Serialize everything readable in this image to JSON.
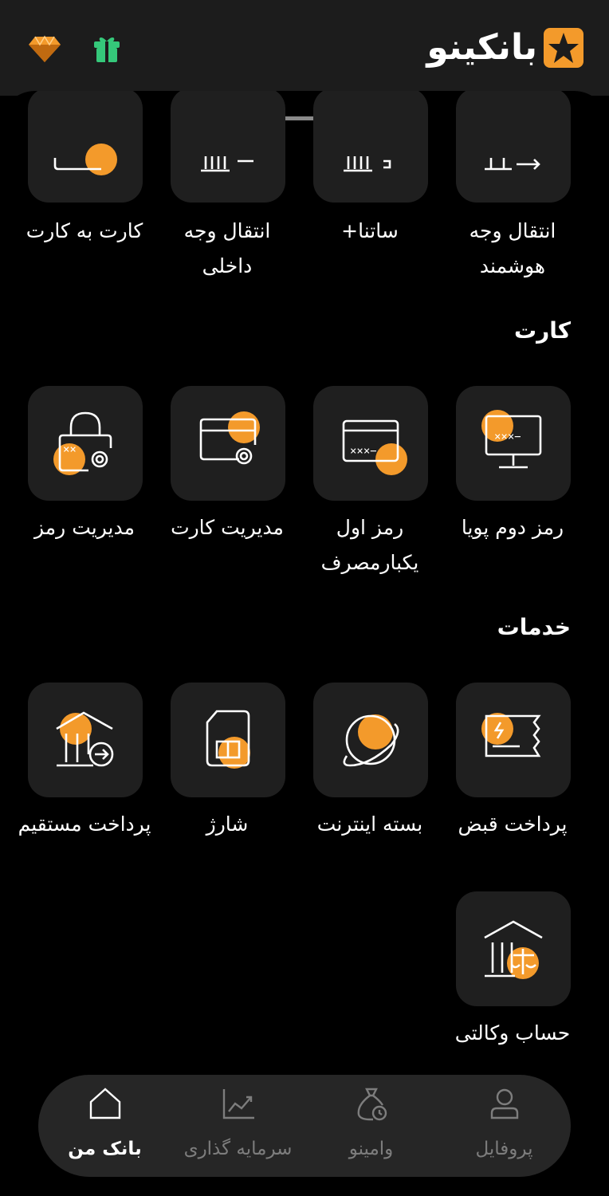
{
  "header": {
    "logo_text": "بانکینو"
  },
  "top_row": [
    {
      "label": "انتقال وجه هوشمند"
    },
    {
      "label": "ساتنا+"
    },
    {
      "label": "انتقال وجه داخلی"
    },
    {
      "label": "کارت به کارت"
    }
  ],
  "card_section": {
    "title": "کارت",
    "items": [
      {
        "label": "رمز دوم پویا"
      },
      {
        "label": "رمز اول یکبارمصرف"
      },
      {
        "label": "مدیریت کارت"
      },
      {
        "label": "مدیریت رمز"
      }
    ]
  },
  "services_section": {
    "title": "خدمات",
    "items": [
      {
        "label": "پرداخت قبض"
      },
      {
        "label": "بسته اینترنت"
      },
      {
        "label": "شارژ"
      },
      {
        "label": "پرداخت مستقیم"
      },
      {
        "label": "حساب وکالتی"
      }
    ]
  },
  "bottom_nav": [
    {
      "label": "پروفایل"
    },
    {
      "label": "وامینو"
    },
    {
      "label": "سرمایه گذاری"
    },
    {
      "label": "بانک من",
      "active": true
    }
  ],
  "colors": {
    "accent": "#f39a2b",
    "tile": "#1f1f1f",
    "header": "#1c1c1c"
  }
}
